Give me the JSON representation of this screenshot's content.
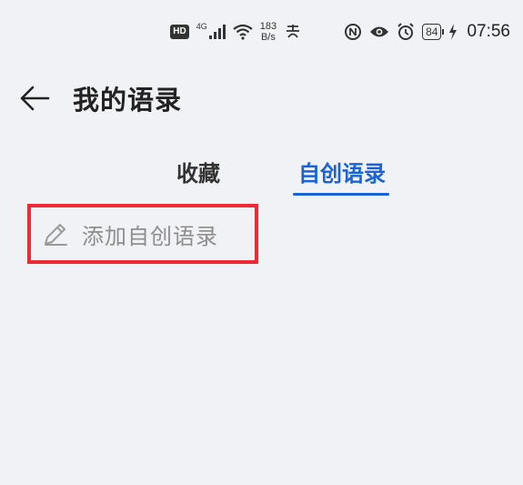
{
  "status_bar": {
    "hd": "HD",
    "network": "4G",
    "speed_value": "183",
    "speed_unit": "B/s",
    "battery": "84",
    "time": "07:56",
    "icons": [
      "hd-badge",
      "signal-icon",
      "wifi-icon",
      "pay-icon",
      "nfc-icon",
      "eye-icon",
      "alarm-icon",
      "battery-icon",
      "charging-icon"
    ]
  },
  "header": {
    "back_icon": "arrow-left-icon",
    "title": "我的语录"
  },
  "tabs": [
    {
      "label": "收藏",
      "active": false
    },
    {
      "label": "自创语录",
      "active": true
    }
  ],
  "accent_color": "#1a63d6",
  "highlight_color": "#ee2a36",
  "add_quote": {
    "icon": "pencil-icon",
    "label": "添加自创语录"
  }
}
